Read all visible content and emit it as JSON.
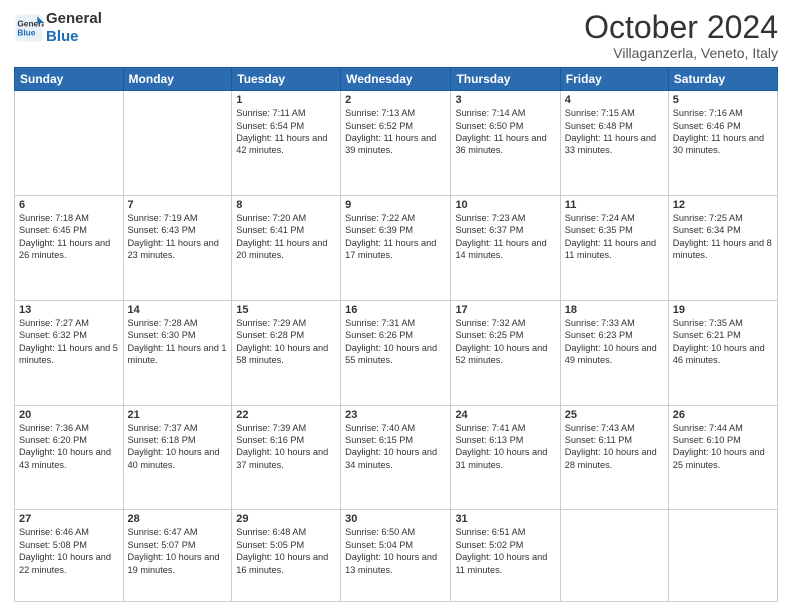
{
  "header": {
    "logo_line1": "General",
    "logo_line2": "Blue",
    "month": "October 2024",
    "location": "Villaganzerla, Veneto, Italy"
  },
  "days_of_week": [
    "Sunday",
    "Monday",
    "Tuesday",
    "Wednesday",
    "Thursday",
    "Friday",
    "Saturday"
  ],
  "weeks": [
    [
      {
        "day": "",
        "info": ""
      },
      {
        "day": "",
        "info": ""
      },
      {
        "day": "1",
        "info": "Sunrise: 7:11 AM\nSunset: 6:54 PM\nDaylight: 11 hours and 42 minutes."
      },
      {
        "day": "2",
        "info": "Sunrise: 7:13 AM\nSunset: 6:52 PM\nDaylight: 11 hours and 39 minutes."
      },
      {
        "day": "3",
        "info": "Sunrise: 7:14 AM\nSunset: 6:50 PM\nDaylight: 11 hours and 36 minutes."
      },
      {
        "day": "4",
        "info": "Sunrise: 7:15 AM\nSunset: 6:48 PM\nDaylight: 11 hours and 33 minutes."
      },
      {
        "day": "5",
        "info": "Sunrise: 7:16 AM\nSunset: 6:46 PM\nDaylight: 11 hours and 30 minutes."
      }
    ],
    [
      {
        "day": "6",
        "info": "Sunrise: 7:18 AM\nSunset: 6:45 PM\nDaylight: 11 hours and 26 minutes."
      },
      {
        "day": "7",
        "info": "Sunrise: 7:19 AM\nSunset: 6:43 PM\nDaylight: 11 hours and 23 minutes."
      },
      {
        "day": "8",
        "info": "Sunrise: 7:20 AM\nSunset: 6:41 PM\nDaylight: 11 hours and 20 minutes."
      },
      {
        "day": "9",
        "info": "Sunrise: 7:22 AM\nSunset: 6:39 PM\nDaylight: 11 hours and 17 minutes."
      },
      {
        "day": "10",
        "info": "Sunrise: 7:23 AM\nSunset: 6:37 PM\nDaylight: 11 hours and 14 minutes."
      },
      {
        "day": "11",
        "info": "Sunrise: 7:24 AM\nSunset: 6:35 PM\nDaylight: 11 hours and 11 minutes."
      },
      {
        "day": "12",
        "info": "Sunrise: 7:25 AM\nSunset: 6:34 PM\nDaylight: 11 hours and 8 minutes."
      }
    ],
    [
      {
        "day": "13",
        "info": "Sunrise: 7:27 AM\nSunset: 6:32 PM\nDaylight: 11 hours and 5 minutes."
      },
      {
        "day": "14",
        "info": "Sunrise: 7:28 AM\nSunset: 6:30 PM\nDaylight: 11 hours and 1 minute."
      },
      {
        "day": "15",
        "info": "Sunrise: 7:29 AM\nSunset: 6:28 PM\nDaylight: 10 hours and 58 minutes."
      },
      {
        "day": "16",
        "info": "Sunrise: 7:31 AM\nSunset: 6:26 PM\nDaylight: 10 hours and 55 minutes."
      },
      {
        "day": "17",
        "info": "Sunrise: 7:32 AM\nSunset: 6:25 PM\nDaylight: 10 hours and 52 minutes."
      },
      {
        "day": "18",
        "info": "Sunrise: 7:33 AM\nSunset: 6:23 PM\nDaylight: 10 hours and 49 minutes."
      },
      {
        "day": "19",
        "info": "Sunrise: 7:35 AM\nSunset: 6:21 PM\nDaylight: 10 hours and 46 minutes."
      }
    ],
    [
      {
        "day": "20",
        "info": "Sunrise: 7:36 AM\nSunset: 6:20 PM\nDaylight: 10 hours and 43 minutes."
      },
      {
        "day": "21",
        "info": "Sunrise: 7:37 AM\nSunset: 6:18 PM\nDaylight: 10 hours and 40 minutes."
      },
      {
        "day": "22",
        "info": "Sunrise: 7:39 AM\nSunset: 6:16 PM\nDaylight: 10 hours and 37 minutes."
      },
      {
        "day": "23",
        "info": "Sunrise: 7:40 AM\nSunset: 6:15 PM\nDaylight: 10 hours and 34 minutes."
      },
      {
        "day": "24",
        "info": "Sunrise: 7:41 AM\nSunset: 6:13 PM\nDaylight: 10 hours and 31 minutes."
      },
      {
        "day": "25",
        "info": "Sunrise: 7:43 AM\nSunset: 6:11 PM\nDaylight: 10 hours and 28 minutes."
      },
      {
        "day": "26",
        "info": "Sunrise: 7:44 AM\nSunset: 6:10 PM\nDaylight: 10 hours and 25 minutes."
      }
    ],
    [
      {
        "day": "27",
        "info": "Sunrise: 6:46 AM\nSunset: 5:08 PM\nDaylight: 10 hours and 22 minutes."
      },
      {
        "day": "28",
        "info": "Sunrise: 6:47 AM\nSunset: 5:07 PM\nDaylight: 10 hours and 19 minutes."
      },
      {
        "day": "29",
        "info": "Sunrise: 6:48 AM\nSunset: 5:05 PM\nDaylight: 10 hours and 16 minutes."
      },
      {
        "day": "30",
        "info": "Sunrise: 6:50 AM\nSunset: 5:04 PM\nDaylight: 10 hours and 13 minutes."
      },
      {
        "day": "31",
        "info": "Sunrise: 6:51 AM\nSunset: 5:02 PM\nDaylight: 10 hours and 11 minutes."
      },
      {
        "day": "",
        "info": ""
      },
      {
        "day": "",
        "info": ""
      }
    ]
  ]
}
